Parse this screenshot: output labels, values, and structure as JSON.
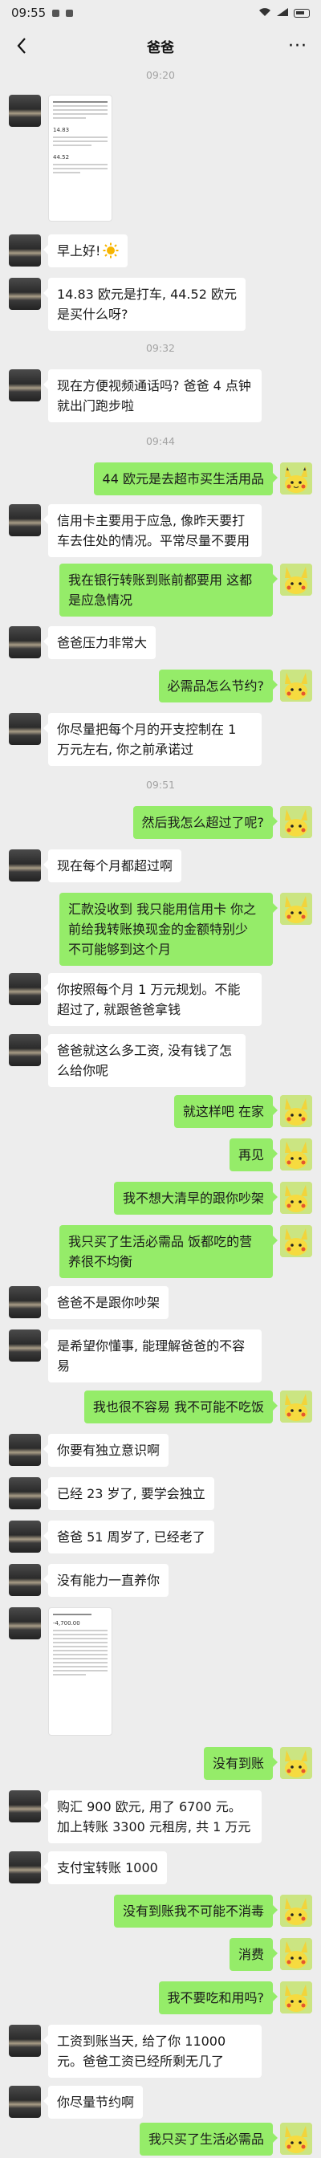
{
  "status_bar": {
    "time": "09:55"
  },
  "header": {
    "title": "爸爸",
    "more": "···"
  },
  "timestamps": [
    "09:20",
    "09:32",
    "09:44",
    "09:51"
  ],
  "receipt_1": {
    "amount_a": "14.83",
    "amount_b": "44.52"
  },
  "receipt_2": {
    "amount": "-4,700.00"
  },
  "messages": [
    {
      "side": "left",
      "text": "早上好!"
    },
    {
      "side": "left",
      "text": "14.83 欧元是打车, 44.52 欧元是买什么呀?"
    },
    {
      "side": "left",
      "text": "现在方便视频通话吗? 爸爸 4 点钟就出门跑步啦"
    },
    {
      "side": "right",
      "text": "44 欧元是去超市买生活用品"
    },
    {
      "side": "left",
      "text": "信用卡主要用于应急, 像昨天要打车去住处的情况。平常尽量不要用"
    },
    {
      "side": "right",
      "text": "我在银行转账到账前都要用 这都是应急情况"
    },
    {
      "side": "left",
      "text": "爸爸压力非常大"
    },
    {
      "side": "right",
      "text": "必需品怎么节约?"
    },
    {
      "side": "left",
      "text": "你尽量把每个月的开支控制在 1 万元左右, 你之前承诺过"
    },
    {
      "side": "right",
      "text": "然后我怎么超过了呢?"
    },
    {
      "side": "left",
      "text": "现在每个月都超过啊"
    },
    {
      "side": "right",
      "text": "汇款没收到 我只能用信用卡 你之前给我转账换现金的金额特别少 不可能够到这个月"
    },
    {
      "side": "left",
      "text": "你按照每个月 1 万元规划。不能超过了, 就跟爸爸拿钱"
    },
    {
      "side": "left",
      "text": "爸爸就这么多工资, 没有钱了怎么给你呢"
    },
    {
      "side": "right",
      "text": "就这样吧 在家"
    },
    {
      "side": "right",
      "text": "再见"
    },
    {
      "side": "right",
      "text": "我不想大清早的跟你吵架"
    },
    {
      "side": "right",
      "text": "我只买了生活必需品 饭都吃的营养很不均衡"
    },
    {
      "side": "left",
      "text": "爸爸不是跟你吵架"
    },
    {
      "side": "left",
      "text": "是希望你懂事, 能理解爸爸的不容易"
    },
    {
      "side": "right",
      "text": "我也很不容易 我不可能不吃饭"
    },
    {
      "side": "left",
      "text": "你要有独立意识啊"
    },
    {
      "side": "left",
      "text": "已经 23 岁了, 要学会独立"
    },
    {
      "side": "left",
      "text": "爸爸 51 周岁了, 已经老了"
    },
    {
      "side": "left",
      "text": "没有能力一直养你"
    },
    {
      "side": "right",
      "text": "没有到账"
    },
    {
      "side": "left",
      "text": "购汇 900 欧元, 用了 6700 元。加上转账 3300 元租房, 共 1 万元"
    },
    {
      "side": "left",
      "text": "支付宝转账 1000"
    },
    {
      "side": "right",
      "text": "没有到账我不可能不消毒"
    },
    {
      "side": "right",
      "text": "消费"
    },
    {
      "side": "right",
      "text": "我不要吃和用吗?"
    },
    {
      "side": "left",
      "text": "工资到账当天, 给了你 11000 元。爸爸工资已经所剩无几了"
    },
    {
      "side": "left",
      "text": "你尽量节约啊"
    },
    {
      "side": "right",
      "text": "我只买了生活必需品"
    }
  ]
}
